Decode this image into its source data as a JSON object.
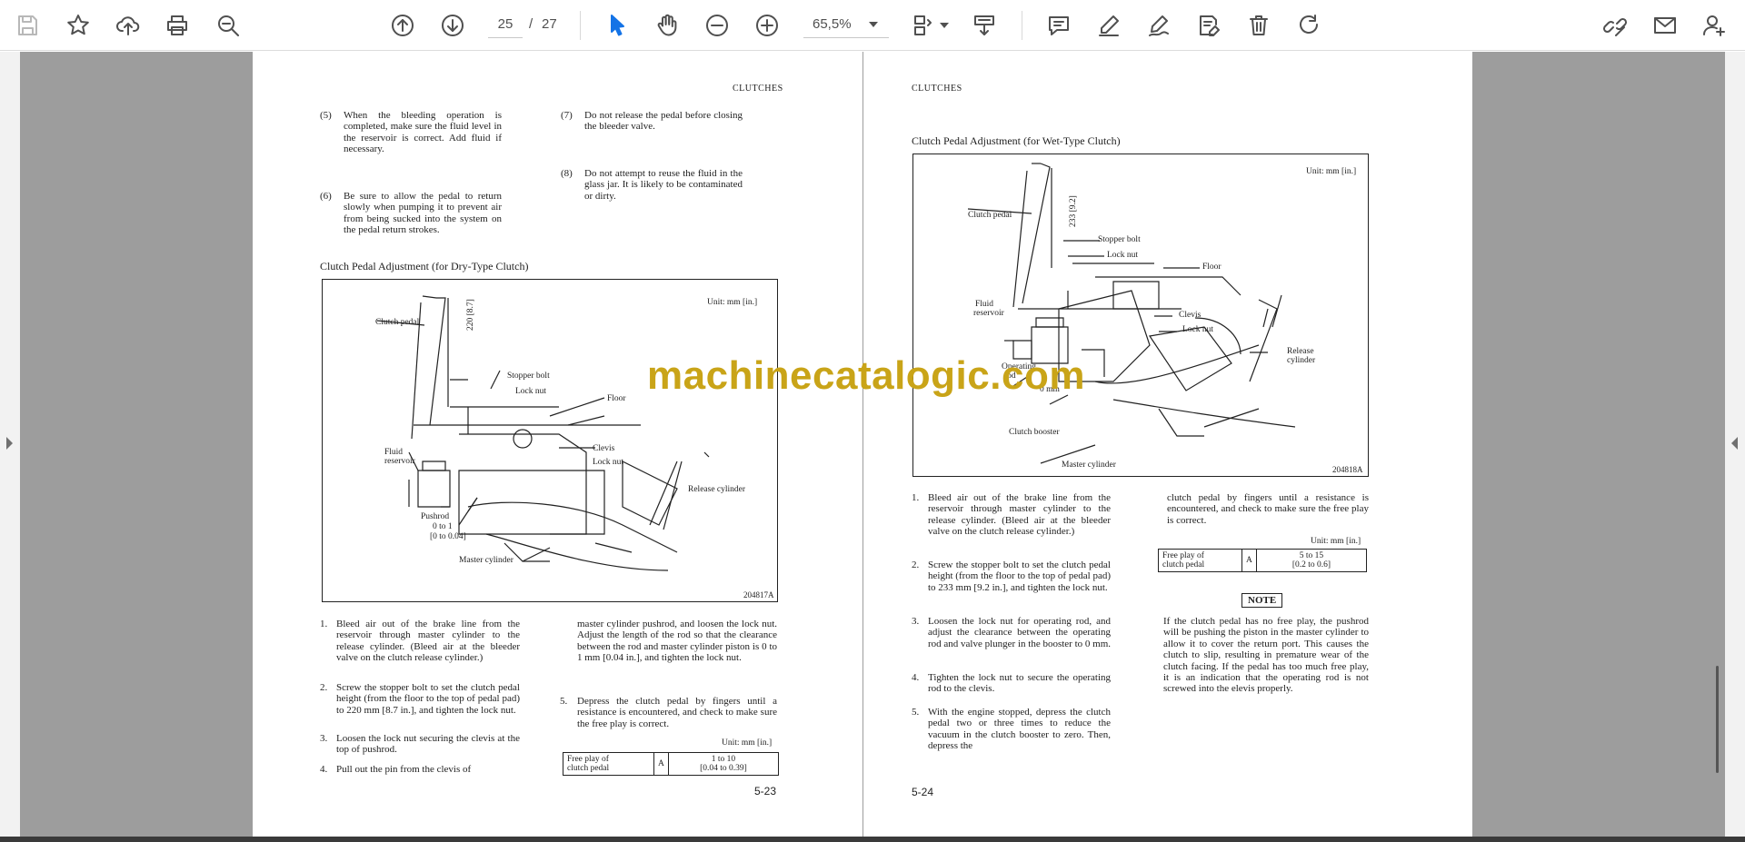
{
  "toolbar": {
    "page_current": "25",
    "page_separator": "/",
    "page_total": "27",
    "zoom": "65,5%"
  },
  "watermark": "machinecatalogic.com",
  "left_page": {
    "header": "CLUTCHES",
    "items_top": [
      {
        "num": "(5)",
        "text": "When the bleeding operation is completed, make sure the fluid level in the reservoir is correct. Add fluid if necessary."
      },
      {
        "num": "(6)",
        "text": "Be sure to allow the pedal to return slowly when pumping it to prevent air from being sucked into the system on the pedal return strokes."
      },
      {
        "num": "(7)",
        "text": "Do not release the pedal before closing the bleeder valve."
      },
      {
        "num": "(8)",
        "text": "Do not attempt to reuse the fluid in the glass jar. It is likely to be contaminated or dirty."
      }
    ],
    "section_title": "Clutch Pedal Adjustment (for Dry-Type Clutch)",
    "figure": {
      "unit": "Unit: mm [in.]",
      "code": "204817A",
      "labels": {
        "clutch_pedal": "Clutch pedal",
        "dimension": "220 [8.7]",
        "stopper_bolt": "Stopper bolt",
        "lock_nut_1": "Lock nut",
        "floor": "Floor",
        "fluid_reservoir_1": "Fluid",
        "fluid_reservoir_2": "reservoir",
        "clevis": "Clevis",
        "lock_nut_2": "Lock nut",
        "release_cylinder": "Release cylinder",
        "pushrod": "Pushrod",
        "pushrod_gap_1": "0 to 1",
        "pushrod_gap_2": "[0 to 0.04]",
        "master_cylinder": "Master cylinder"
      }
    },
    "steps_col1": [
      {
        "num": "1.",
        "text": "Bleed air out of the brake line from the reservoir through master cylinder to the release cylinder. (Bleed air at the bleeder valve on the clutch release cylinder.)"
      },
      {
        "num": "2.",
        "text": "Screw the stopper bolt to set the clutch pedal height (from the floor to the top of pedal pad) to 220 mm [8.7 in.], and tighten the lock nut."
      },
      {
        "num": "3.",
        "text": "Loosen the lock nut securing the clevis at the top of pushrod."
      },
      {
        "num": "4.",
        "text": "Pull out the pin from the clevis of"
      }
    ],
    "steps_col2_cont": "master cylinder pushrod, and loosen the lock nut. Adjust the length of the rod so that the clearance between the rod and master cylinder piston is 0 to 1 mm [0.04 in.], and tighten the lock nut.",
    "step5": {
      "num": "5.",
      "text": "Depress the clutch pedal by fingers until a resistance is encountered, and check to make sure the free play is correct."
    },
    "table_unit": "Unit: mm [in.]",
    "table": {
      "label_1": "Free play of",
      "label_2": "clutch pedal",
      "sym": "A",
      "value_1": "1 to 10",
      "value_2": "[0.04 to 0.39]"
    },
    "page_number": "5-23"
  },
  "right_page": {
    "header": "CLUTCHES",
    "section_title": "Clutch Pedal Adjustment (for Wet-Type Clutch)",
    "figure": {
      "unit": "Unit: mm [in.]",
      "code": "204818A",
      "labels": {
        "dimension": "233 [9.2]",
        "clutch_pedal": "Clutch pedal",
        "stopper_bolt": "Stopper bolt",
        "lock_nut_1": "Lock nut",
        "floor": "Floor",
        "fluid_reservoir_1": "Fluid",
        "fluid_reservoir_2": "reservoir",
        "clevis": "Clevis",
        "lock_nut_2": "Lock nut",
        "release_cylinder_1": "Release",
        "release_cylinder_2": "cylinder",
        "operating_rod_1": "Operating",
        "operating_rod_2": "rod",
        "zero_mm": "0 mm",
        "clutch_booster": "Clutch booster",
        "master_cylinder": "Master cylinder"
      }
    },
    "steps_col1": [
      {
        "num": "1.",
        "text": "Bleed air out of the brake line from the reservoir through master cylinder to the release cylinder. (Bleed air at the bleeder valve on the clutch release cylinder.)"
      },
      {
        "num": "2.",
        "text": "Screw the stopper bolt to set the clutch pedal height (from the floor to the top of pedal pad) to 233 mm [9.2 in.], and tighten the lock nut."
      },
      {
        "num": "3.",
        "text": "Loosen the lock nut for operating rod, and adjust the clearance between the operating rod and valve plunger in the booster to 0 mm."
      },
      {
        "num": "4.",
        "text": "Tighten the lock nut to secure the operating rod to the clevis."
      },
      {
        "num": "5.",
        "text": "With the engine stopped, depress the clutch pedal two or three times to reduce the vacuum in the clutch booster to zero. Then, depress the"
      }
    ],
    "col2_cont": "clutch pedal by fingers until a resistance is encountered, and check to make sure the free play is correct.",
    "table_unit": "Unit: mm [in.]",
    "table": {
      "label_1": "Free play of",
      "label_2": "clutch pedal",
      "sym": "A",
      "value_1": "5 to 15",
      "value_2": "[0.2 to 0.6]"
    },
    "note_title": "NOTE",
    "note_text": "If the clutch pedal has no free play, the pushrod will be pushing the piston in the master cylinder to allow it to cover the return port. This causes the clutch to slip, resulting in premature wear of the clutch facing. If the pedal has too much free play, it is an indication that the operating rod is not screwed into the elevis properly.",
    "page_number": "5-24"
  }
}
